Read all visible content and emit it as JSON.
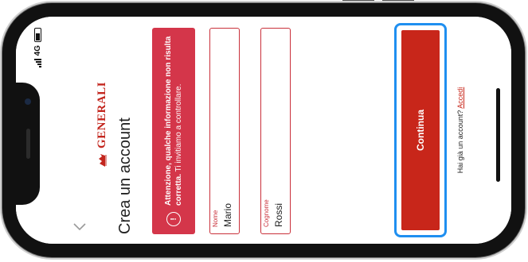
{
  "status_bar": {
    "network": "4G"
  },
  "nav": {
    "back_icon": "chevron-left-icon"
  },
  "brand": {
    "name": "GENERALI",
    "color": "#c3261e"
  },
  "page": {
    "title": "Crea un account"
  },
  "alert": {
    "strong": "Attenzione, qualche informazione non risulta corretta.",
    "text": " Ti invitiamo a controllare.",
    "icon": "exclamation-circle-icon",
    "color": "#d4364a"
  },
  "form": {
    "first_name": {
      "label": "Nome",
      "value": "Mario"
    },
    "last_name": {
      "label": "Cognome",
      "value": "Rossi"
    }
  },
  "actions": {
    "continue_label": "Continua",
    "accent": "#c8261a",
    "focus_color": "#1f8ff0"
  },
  "footer": {
    "prompt": "Hai già un account?",
    "login_link": "Accedi"
  }
}
